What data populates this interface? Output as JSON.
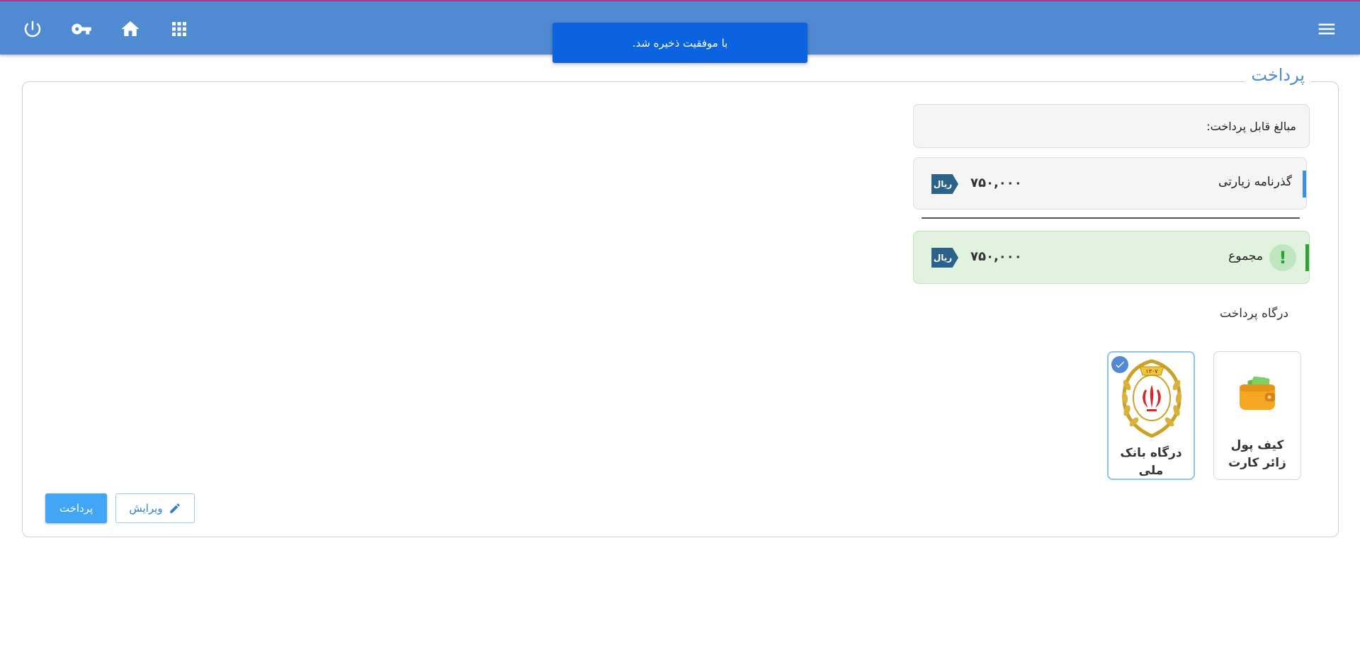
{
  "topbar": {
    "icons": [
      "power-icon",
      "key-icon",
      "home-icon",
      "apps-grid-icon",
      "menu-icon"
    ],
    "color": "#4f8ad3"
  },
  "toast": {
    "message": "با موفقیت ذخیره شد."
  },
  "panel": {
    "title": "پرداخت"
  },
  "payable": {
    "header": "مبالغ قابل پرداخت:",
    "items": [
      {
        "label": "گذرنامه زیارتی",
        "amount": "۷۵۰,۰۰۰",
        "currency": "ریال"
      }
    ],
    "total": {
      "label": "مجموع",
      "amount": "۷۵۰,۰۰۰",
      "currency": "ریال",
      "icon": "!"
    }
  },
  "gateways": {
    "title": "درگاه پرداخت",
    "options": [
      {
        "label": "کیف پول زائر کارت",
        "icon": "wallet-icon",
        "selected": false
      },
      {
        "label": "درگاه بانک ملی",
        "icon": "bank-melli-logo",
        "selected": true,
        "logo_year": "۱۳۰۷"
      }
    ]
  },
  "actions": {
    "edit_label": "ویرایش",
    "pay_label": "پرداخت"
  }
}
